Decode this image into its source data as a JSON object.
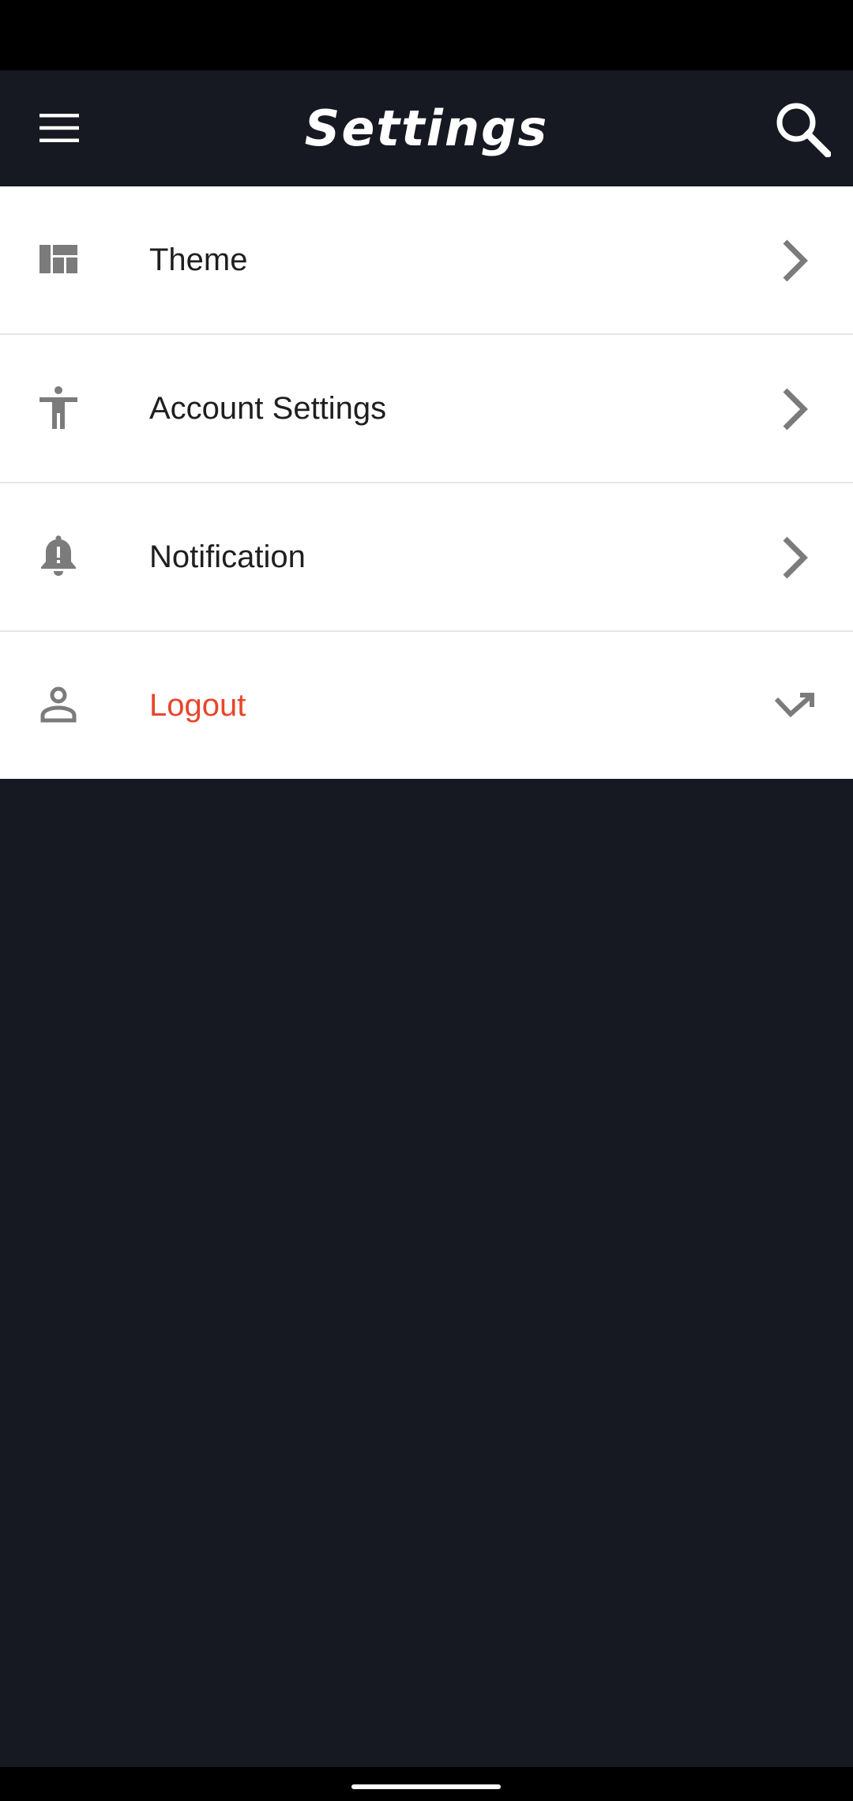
{
  "app_bar": {
    "title": "Settings",
    "menu_icon": "menu-icon",
    "search_icon": "search-icon"
  },
  "settings": {
    "items": [
      {
        "label": "Theme",
        "icon": "dashboard-icon",
        "trailing": "chevron-right-icon"
      },
      {
        "label": "Account Settings",
        "icon": "accessibility-icon",
        "trailing": "chevron-right-icon"
      },
      {
        "label": "Notification",
        "icon": "notification-important-icon",
        "trailing": "chevron-right-icon"
      },
      {
        "label": "Logout",
        "icon": "person-icon",
        "trailing": "call-missed-outgoing-icon"
      }
    ]
  },
  "colors": {
    "background": "#171922",
    "app_bar": "#171922",
    "list_background": "#ffffff",
    "text": "#1f1f1f",
    "icon_gray": "#7b7b7b",
    "logout_accent": "#e8452c"
  }
}
